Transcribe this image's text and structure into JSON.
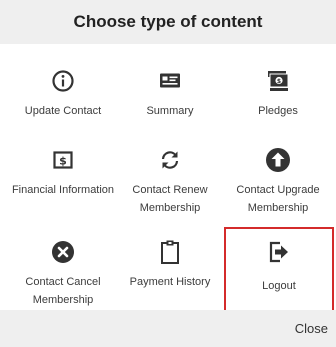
{
  "dialog": {
    "title": "Choose type of content",
    "close_label": "Close",
    "selection_color": "#d42b2b"
  },
  "tiles": [
    {
      "label": "Update Contact",
      "icon": "info-circle-icon"
    },
    {
      "label": "Summary",
      "icon": "id-card-icon"
    },
    {
      "label": "Pledges",
      "icon": "money-stack-icon"
    },
    {
      "label": "Financial Information",
      "icon": "dollar-square-icon"
    },
    {
      "label": "Contact Renew Membership",
      "icon": "refresh-icon"
    },
    {
      "label": "Contact Upgrade Membership",
      "icon": "arrow-up-circle-icon"
    },
    {
      "label": "Contact Cancel Membership",
      "icon": "x-circle-icon"
    },
    {
      "label": "Payment History",
      "icon": "clipboard-icon"
    },
    {
      "label": "Logout",
      "icon": "sign-out-icon",
      "selected": true
    }
  ]
}
